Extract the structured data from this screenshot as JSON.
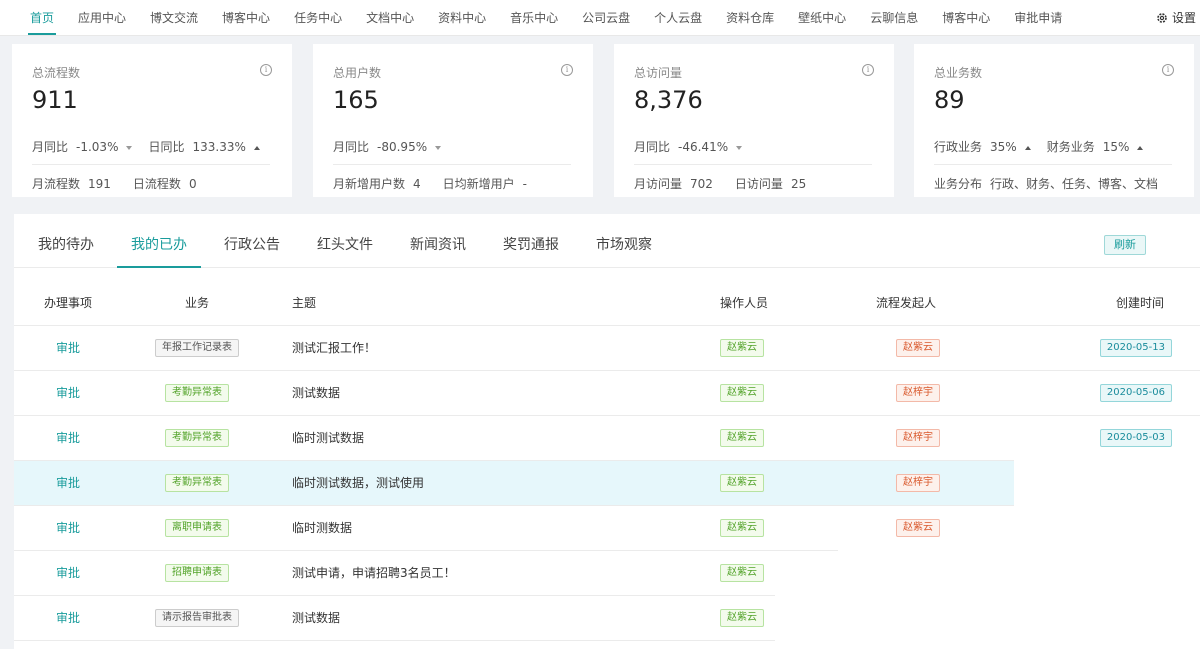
{
  "nav": {
    "items": [
      "首页",
      "应用中心",
      "博文交流",
      "博客中心",
      "任务中心",
      "文档中心",
      "资料中心",
      "音乐中心",
      "公司云盘",
      "个人云盘",
      "资料仓库",
      "壁纸中心",
      "云聊信息",
      "博客中心",
      "审批申请"
    ],
    "settings_label": "设置"
  },
  "cards": [
    {
      "title": "总流程数",
      "value": "911",
      "row1": [
        {
          "label": "月同比",
          "value": "-1.03%",
          "trend": "down"
        },
        {
          "label": "日同比",
          "value": "133.33%",
          "trend": "up"
        }
      ],
      "row2": [
        {
          "label": "月流程数",
          "value": "191"
        },
        {
          "label": "日流程数",
          "value": "0"
        }
      ]
    },
    {
      "title": "总用户数",
      "value": "165",
      "row1": [
        {
          "label": "月同比",
          "value": "-80.95%",
          "trend": "down"
        }
      ],
      "row2": [
        {
          "label": "月新增用户数",
          "value": "4"
        },
        {
          "label": "日均新增用户",
          "value": "-"
        }
      ]
    },
    {
      "title": "总访问量",
      "value": "8,376",
      "row1": [
        {
          "label": "月同比",
          "value": "-46.41%",
          "trend": "down"
        }
      ],
      "row2": [
        {
          "label": "月访问量",
          "value": "702"
        },
        {
          "label": "日访问量",
          "value": "25"
        }
      ]
    },
    {
      "title": "总业务数",
      "value": "89",
      "row1": [
        {
          "label": "行政业务",
          "value": "35%",
          "trend": "up"
        },
        {
          "label": "财务业务",
          "value": "15%",
          "trend": "up"
        }
      ],
      "row2": [
        {
          "label": "业务分布",
          "value": "行政、财务、任务、博客、文档"
        }
      ]
    }
  ],
  "tabs": [
    "我的待办",
    "我的已办",
    "行政公告",
    "红头文件",
    "新闻资讯",
    "奖罚通报",
    "市场观察"
  ],
  "active_tab": "我的已办",
  "refresh_label": "刷新",
  "table": {
    "headers": [
      "办理事项",
      "业务",
      "主题",
      "操作人员",
      "流程发起人",
      "创建时间"
    ],
    "rows": [
      {
        "action": "审批",
        "biz": "年报工作记录表",
        "biz_style": "gray",
        "topic": "测试汇报工作！",
        "operator": "赵紫云",
        "initiator": "赵紫云",
        "time": "2020-05-13"
      },
      {
        "action": "审批",
        "biz": "考勤异常表",
        "biz_style": "green",
        "topic": "测试数据",
        "operator": "赵紫云",
        "initiator": "赵梓宇",
        "time": "2020-05-06"
      },
      {
        "action": "审批",
        "biz": "考勤异常表",
        "biz_style": "green",
        "topic": "临时测试数据",
        "operator": "赵紫云",
        "initiator": "赵梓宇",
        "time": "2020-05-03"
      },
      {
        "action": "审批",
        "biz": "考勤异常表",
        "biz_style": "green",
        "topic": "临时测试数据，测试使用",
        "operator": "赵紫云",
        "initiator": "赵梓宇",
        "time": ""
      },
      {
        "action": "审批",
        "biz": "离职申请表",
        "biz_style": "green",
        "topic": "临时测数据",
        "operator": "赵紫云",
        "initiator": "赵紫云",
        "time": ""
      },
      {
        "action": "审批",
        "biz": "招聘申请表",
        "biz_style": "green",
        "topic": "测试申请，申请招聘3名员工！",
        "operator": "赵紫云",
        "initiator": "",
        "time": ""
      },
      {
        "action": "审批",
        "biz": "请示报告审批表",
        "biz_style": "gray",
        "topic": "测试数据",
        "operator": "赵紫云",
        "initiator": "",
        "time": ""
      }
    ]
  }
}
